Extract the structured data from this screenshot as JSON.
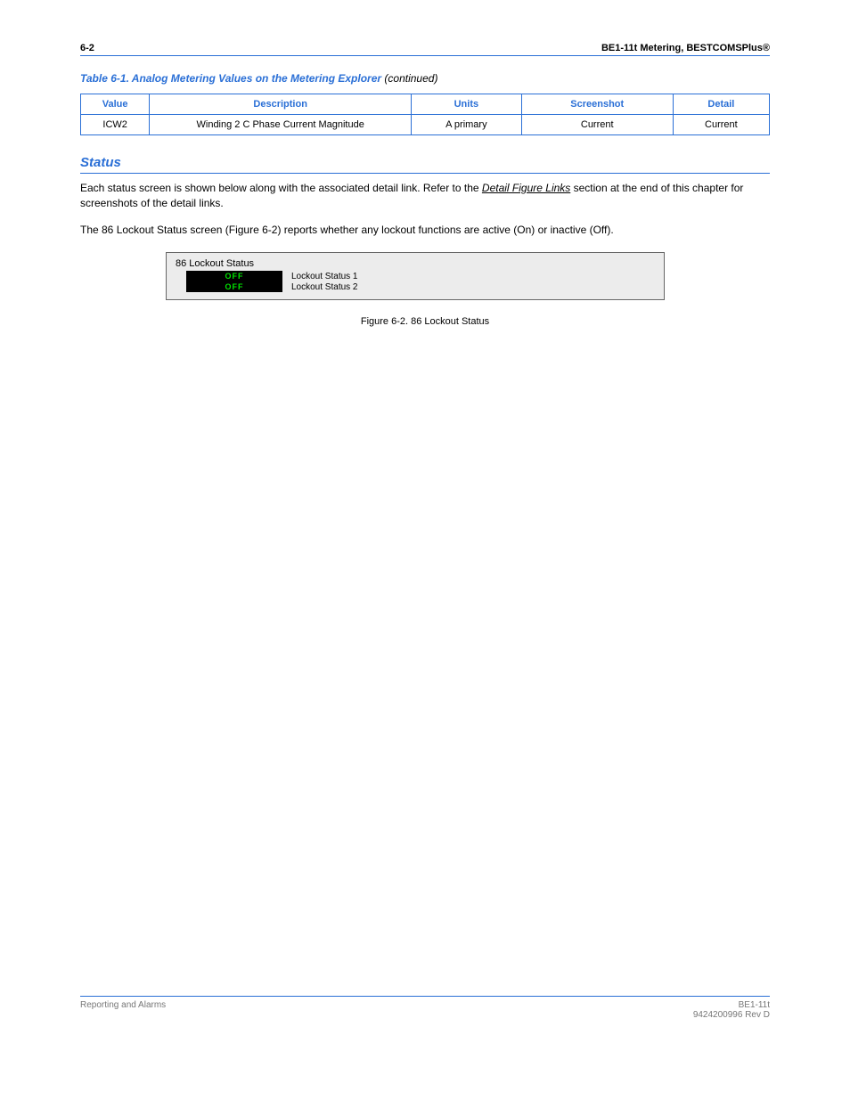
{
  "header": {
    "page_label": "6-2",
    "title": "BE1-11t Metering, BESTCOMSPlus®"
  },
  "continued": {
    "prefix": "Table 6-1. ",
    "label": "Analog Metering Values on the Metering Explorer ",
    "suffix": "(continued)"
  },
  "spec_table": {
    "headers": [
      "Value",
      "Description",
      "Units",
      "Screenshot",
      "Detail"
    ],
    "row": [
      "ICW2",
      "Winding 2 C Phase Current Magnitude",
      "A primary",
      "Current",
      "Current"
    ]
  },
  "section_status": {
    "title": "Status",
    "intro_before_link": "Each status screen is shown below along with the associated detail link. Refer to the ",
    "link_text": "Detail Figure Links",
    "intro_after_link": " section at the end of this chapter for screenshots of the detail links.",
    "para2": "The 86 Lockout Status screen (Figure 6-2) reports whether any lockout functions are active (On) or inactive (Off)."
  },
  "lockout_panel": {
    "title": "86 Lockout Status",
    "rows": [
      {
        "value": "OFF",
        "label": "Lockout Status 1"
      },
      {
        "value": "OFF",
        "label": "Lockout Status 2"
      }
    ]
  },
  "caption": "Figure 6-2. 86 Lockout Status",
  "footer": {
    "left": "Reporting and Alarms",
    "right_line1": "BE1-11t",
    "right_line2": "9424200996 Rev D"
  }
}
